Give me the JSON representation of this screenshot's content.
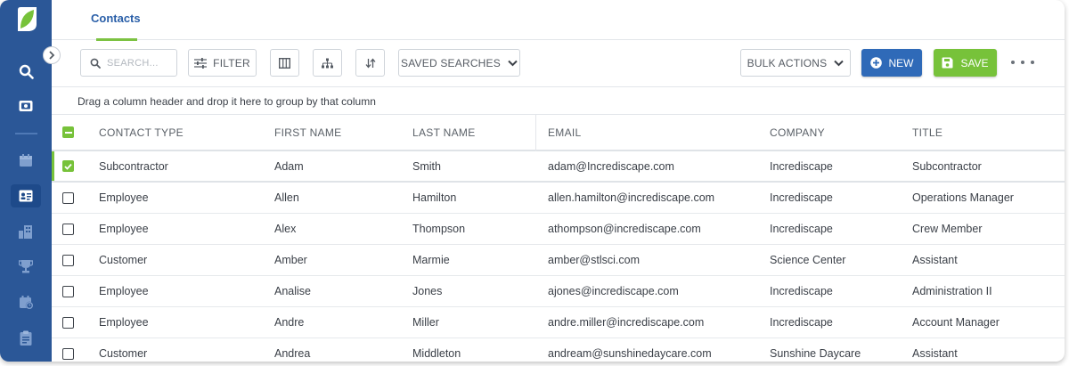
{
  "tabs": [
    {
      "label": "Contacts",
      "active": true
    }
  ],
  "toolbar": {
    "search_placeholder": "SEARCH...",
    "filter_label": "FILTER",
    "saved_searches_label": "SAVED SEARCHES",
    "bulk_actions_label": "BULK ACTIONS",
    "new_label": "NEW",
    "save_label": "SAVE"
  },
  "group_hint": "Drag a column header and drop it here to group by that column",
  "grid": {
    "columns": [
      "CONTACT TYPE",
      "FIRST NAME",
      "LAST NAME",
      "EMAIL",
      "COMPANY",
      "TITLE"
    ],
    "rows": [
      {
        "checked": true,
        "type": "Subcontractor",
        "first": "Adam",
        "last": "Smith",
        "email": "adam@Incrediscape.com",
        "company": "Incrediscape",
        "title": "Subcontractor"
      },
      {
        "checked": false,
        "type": "Employee",
        "first": "Allen",
        "last": "Hamilton",
        "email": "allen.hamilton@incrediscape.com",
        "company": "Incrediscape",
        "title": "Operations Manager"
      },
      {
        "checked": false,
        "type": "Employee",
        "first": "Alex",
        "last": "Thompson",
        "email": "athompson@incrediscape.com",
        "company": "Incrediscape",
        "title": "Crew Member"
      },
      {
        "checked": false,
        "type": "Customer",
        "first": "Amber",
        "last": "Marmie",
        "email": "amber@stlsci.com",
        "company": "Science Center",
        "title": "Assistant"
      },
      {
        "checked": false,
        "type": "Employee",
        "first": "Analise",
        "last": "Jones",
        "email": "ajones@incrediscape.com",
        "company": "Incrediscape",
        "title": "Administration II"
      },
      {
        "checked": false,
        "type": "Employee",
        "first": "Andre",
        "last": "Miller",
        "email": "andre.miller@incrediscape.com",
        "company": "Incrediscape",
        "title": "Account Manager"
      },
      {
        "checked": false,
        "type": "Customer",
        "first": "Andrea",
        "last": "Middleton",
        "email": "andream@sunshinedaycare.com",
        "company": "Sunshine Daycare",
        "title": "Assistant"
      }
    ]
  },
  "colors": {
    "sidebar": "#2b5797",
    "accent_green": "#77c23a",
    "primary_blue": "#2f6ab8",
    "tab_text": "#2a5fa8"
  }
}
